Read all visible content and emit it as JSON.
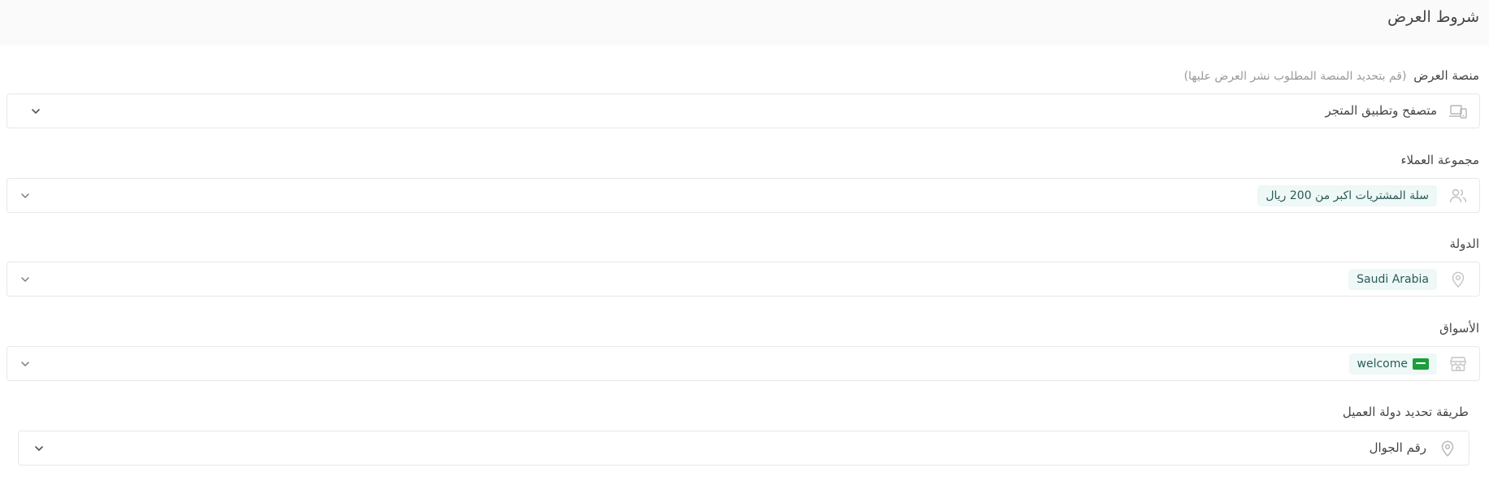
{
  "header": {
    "title": "شروط العرض"
  },
  "fields": {
    "platform": {
      "label": "منصة العرض",
      "hint": "(قم بتحديد المنصة المطلوب نشر العرض عليها)",
      "value": "متصفح وتطبيق المتجر",
      "icon": "devices-icon"
    },
    "customer_group": {
      "label": "مجموعة العملاء",
      "tag": "سلة المشتريات اكبر من 200 ريال",
      "icon": "users-icon"
    },
    "country": {
      "label": "الدولة",
      "tag": "Saudi Arabia",
      "icon": "location-pin-icon"
    },
    "markets": {
      "label": "الأسواق",
      "tag": "welcome",
      "icon": "store-icon",
      "tag_icon": "saudi-flag-icon"
    },
    "country_detection": {
      "label": "طريقة تحديد دولة العميل",
      "value": "رقم الجوال",
      "icon": "location-pin-icon"
    }
  },
  "colors": {
    "header_bg": "#fafafa",
    "tag_bg": "#eef8f6",
    "tag_text": "#2b5b57",
    "border": "#e8e8e8",
    "flag_green": "#1e9d3c"
  }
}
